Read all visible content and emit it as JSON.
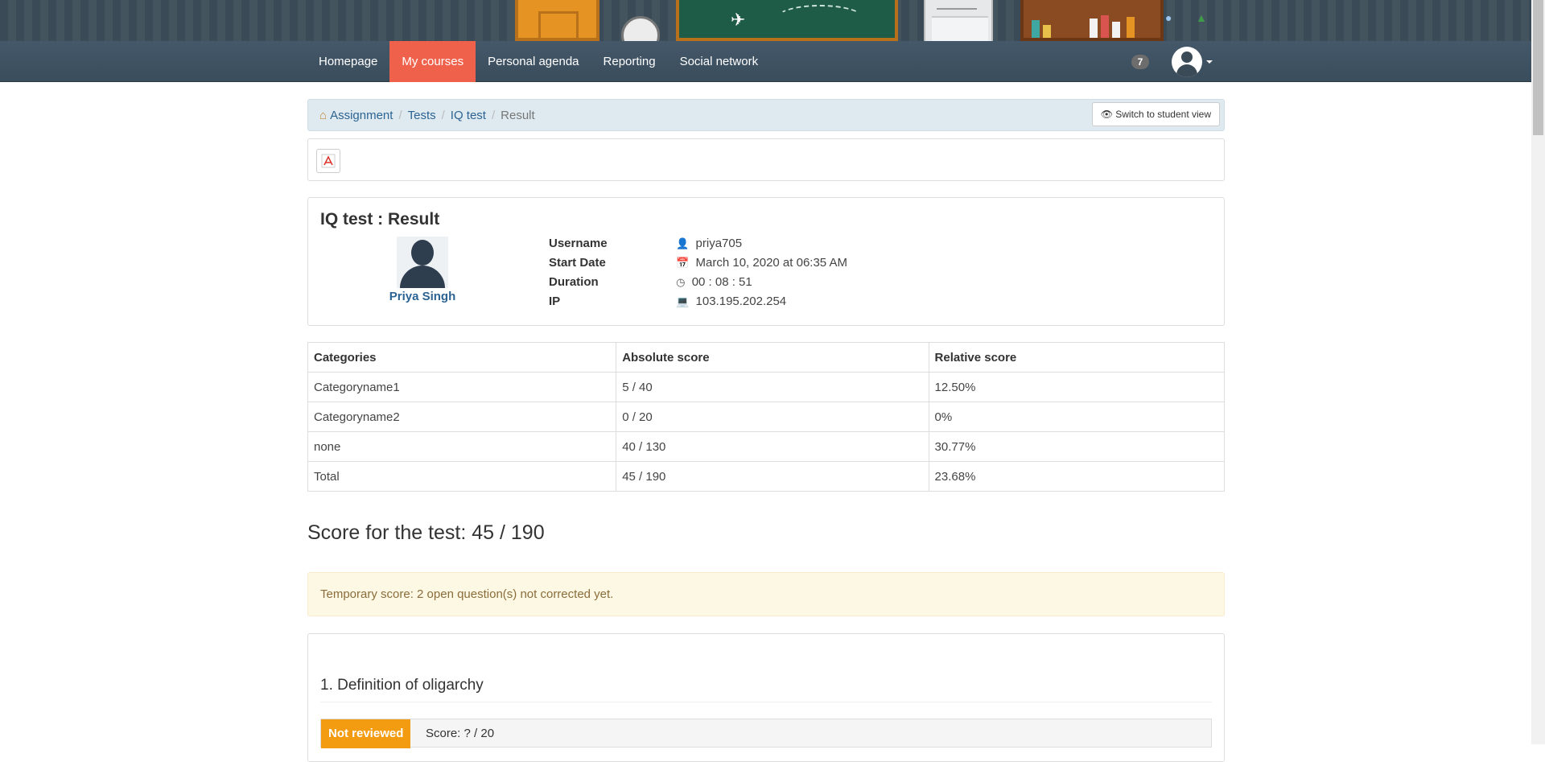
{
  "nav": {
    "items": [
      {
        "label": "Homepage",
        "active": false
      },
      {
        "label": "My courses",
        "active": true
      },
      {
        "label": "Personal agenda",
        "active": false
      },
      {
        "label": "Reporting",
        "active": false
      },
      {
        "label": "Social network",
        "active": false
      }
    ],
    "notification_count": "7"
  },
  "breadcrumb": {
    "items": [
      "Assignment",
      "Tests",
      "IQ test",
      "Result"
    ],
    "separator": "/",
    "switch_button": "Switch to student view"
  },
  "result": {
    "title": "IQ test : Result",
    "user_name": "Priya Singh",
    "fields": [
      {
        "label": "Username",
        "icon": "user-icon",
        "value": "priya705"
      },
      {
        "label": "Start Date",
        "icon": "calendar-icon",
        "value": "March 10, 2020 at 06:35 AM"
      },
      {
        "label": "Duration",
        "icon": "clock-icon",
        "value": "00 : 08 : 51"
      },
      {
        "label": "IP",
        "icon": "laptop-icon",
        "value": "103.195.202.254"
      }
    ]
  },
  "scores_table": {
    "headers": [
      "Categories",
      "Absolute score",
      "Relative score"
    ],
    "rows": [
      [
        "Categoryname1",
        "5 / 40",
        "12.50%"
      ],
      [
        "Categoryname2",
        "0 / 20",
        "0%"
      ],
      [
        "none",
        "40 / 130",
        "30.77%"
      ],
      [
        "Total",
        "45 / 190",
        "23.68%"
      ]
    ]
  },
  "score_heading": "Score for the test: 45 / 190",
  "alert": "Temporary score: 2 open question(s) not corrected yet.",
  "question": {
    "title": "1. Definition of oligarchy",
    "status": "Not reviewed",
    "score": "Score: ? / 20"
  },
  "colors": {
    "nav_active": "#f0614b",
    "link": "#2c6392",
    "not_reviewed": "#f39c12",
    "alert_bg": "#fcf8e3"
  }
}
